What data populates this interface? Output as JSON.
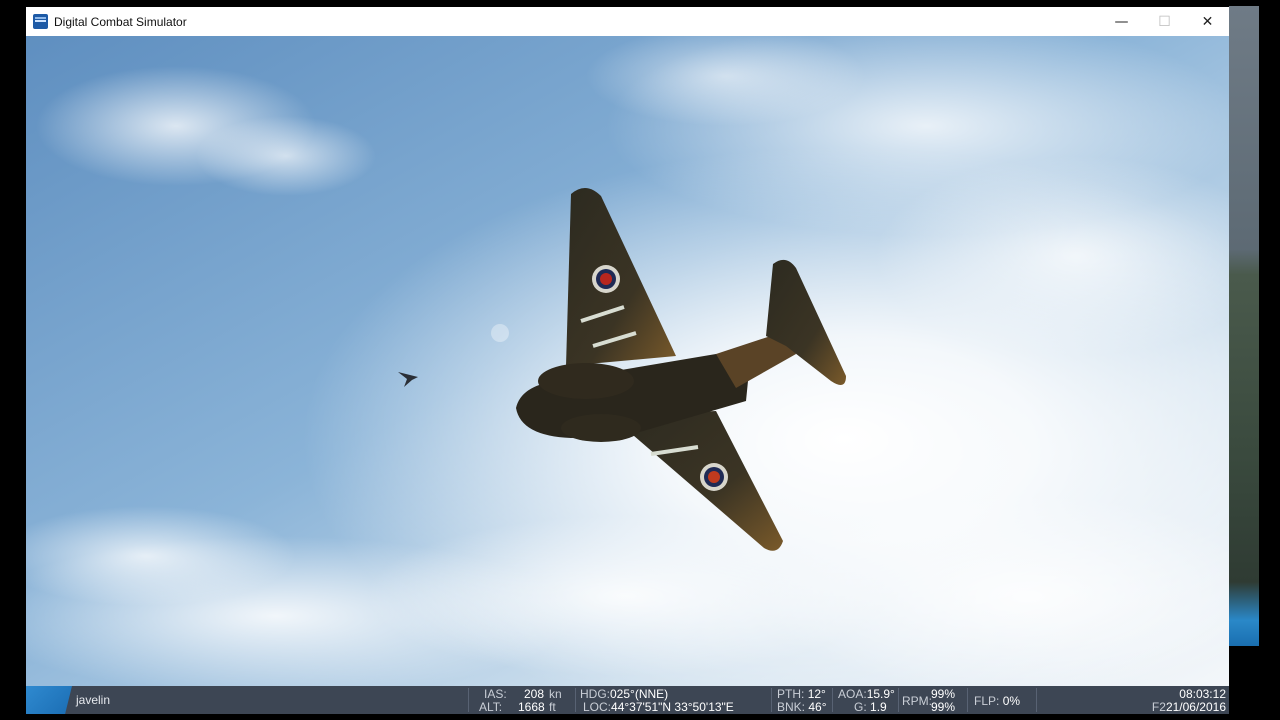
{
  "window": {
    "title": "Digital Combat Simulator",
    "controls": {
      "minimize": "—",
      "maximize": "☐",
      "close": "✕"
    }
  },
  "scene": {
    "description_icon": "aircraft-in-sky"
  },
  "status": {
    "unit": "javelin",
    "ias_label": "IAS:",
    "ias_value": "208",
    "ias_unit": "kn",
    "alt_label": "ALT:",
    "alt_value": "1668",
    "alt_unit": "ft",
    "hdg_label": "HDG:",
    "hdg_value": "025°(NNE)",
    "loc_label": "LOC:",
    "loc_value": "44°37'51\"N 33°50'13\"E",
    "pth_label": "PTH:",
    "pth_value": "12°",
    "bnk_label": "BNK:",
    "bnk_value": "46°",
    "aoa_label": "AOA:",
    "aoa_value": "15.9°",
    "g_label": "G:",
    "g_value": "1.9",
    "rpm_label": "RPM:",
    "rpm_value1": "99%",
    "rpm_value2": "99%",
    "flp_label": "FLP:",
    "flp_value": "0%",
    "time": "08:03:12",
    "frame_label": "F2",
    "date": "21/06/2016"
  },
  "colors": {
    "status_bg": "#3d4654",
    "sky_top": "#6f9cc9",
    "accent_blue": "#1b6db3"
  }
}
